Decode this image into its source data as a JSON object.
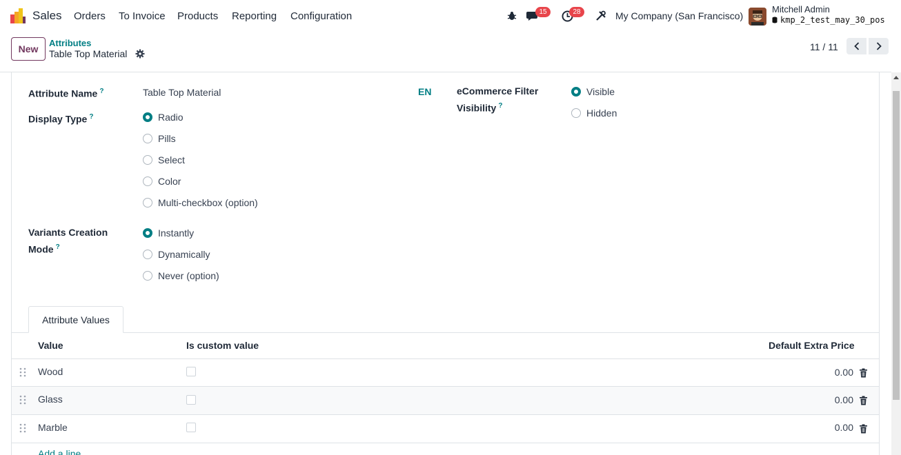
{
  "navbar": {
    "app_name": "Sales",
    "menus": [
      "Orders",
      "To Invoice",
      "Products",
      "Reporting",
      "Configuration"
    ],
    "messages_count": "15",
    "activities_count": "28",
    "company": "My Company (San Francisco)",
    "user_name": "Mitchell Admin",
    "database": "kmp_2_test_may_30_pos"
  },
  "control_panel": {
    "new_label": "New",
    "breadcrumb": "Attributes",
    "record_title": "Table Top Material",
    "pager": "11 / 11"
  },
  "form": {
    "attribute_name_label": "Attribute Name",
    "attribute_name_value": "Table Top Material",
    "lang_label": "EN",
    "tooltip_mark": "?",
    "display_type_label": "Display Type",
    "display_type_options": [
      "Radio",
      "Pills",
      "Select",
      "Color",
      "Multi-checkbox (option)"
    ],
    "display_type_selected": "Radio",
    "variants_label_line1": "Variants Creation",
    "variants_label_line2": "Mode",
    "variants_options": [
      "Instantly",
      "Dynamically",
      "Never (option)"
    ],
    "variants_selected": "Instantly",
    "ecommerce_label_line1": "eCommerce Filter",
    "ecommerce_label_line2": "Visibility",
    "ecommerce_options": [
      "Visible",
      "Hidden"
    ],
    "ecommerce_selected": "Visible"
  },
  "tabs": {
    "attribute_values": "Attribute Values"
  },
  "values_table": {
    "headers": {
      "value": "Value",
      "is_custom": "Is custom value",
      "default_extra_price": "Default Extra Price"
    },
    "rows": [
      {
        "value": "Wood",
        "is_custom": false,
        "price": "0.00"
      },
      {
        "value": "Glass",
        "is_custom": false,
        "price": "0.00"
      },
      {
        "value": "Marble",
        "is_custom": false,
        "price": "0.00"
      }
    ],
    "add_line": "Add a line"
  },
  "colors": {
    "accent": "#017e84",
    "brand": "#71375e",
    "badge": "#e8454b"
  }
}
